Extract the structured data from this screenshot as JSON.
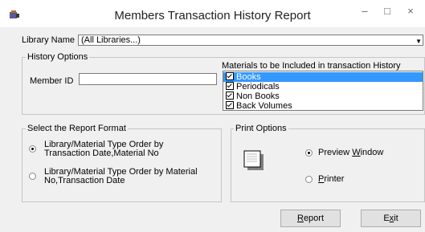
{
  "window": {
    "title": "Members Transaction History Report",
    "minimize": "–",
    "maximize": "□",
    "close": "×"
  },
  "library": {
    "label": "Library Name",
    "value": "(All Libraries...)"
  },
  "history_options": {
    "legend": "History Options",
    "member_id_label": "Member ID",
    "member_id_value": "",
    "materials_label": "Materials to be Included in transaction History",
    "materials": [
      {
        "label": "Books",
        "checked": true,
        "selected": true
      },
      {
        "label": "Periodicals",
        "checked": true,
        "selected": false
      },
      {
        "label": "Non Books",
        "checked": true,
        "selected": false
      },
      {
        "label": "Back Volumes",
        "checked": true,
        "selected": false
      }
    ]
  },
  "report_format": {
    "legend": "Select the Report Format",
    "option1_line1": "Library/Material Type Order by",
    "option1_line2": "Transaction Date,Material No",
    "option1_selected": true,
    "option2_line1": "Library/Material Type Order by Material",
    "option2_line2": "No,Transaction Date",
    "option2_selected": false
  },
  "print_options": {
    "legend": "Print Options",
    "preview_pre": "Preview ",
    "preview_acc": "W",
    "preview_post": "indow",
    "preview_selected": true,
    "printer_acc": "P",
    "printer_post": "rinter",
    "printer_selected": false
  },
  "buttons": {
    "report_acc": "R",
    "report_post": "eport",
    "exit_pre": "E",
    "exit_acc": "x",
    "exit_post": "it"
  },
  "colors": {
    "selection": "#3399ff",
    "dialog_bg": "#f0f0f0"
  }
}
